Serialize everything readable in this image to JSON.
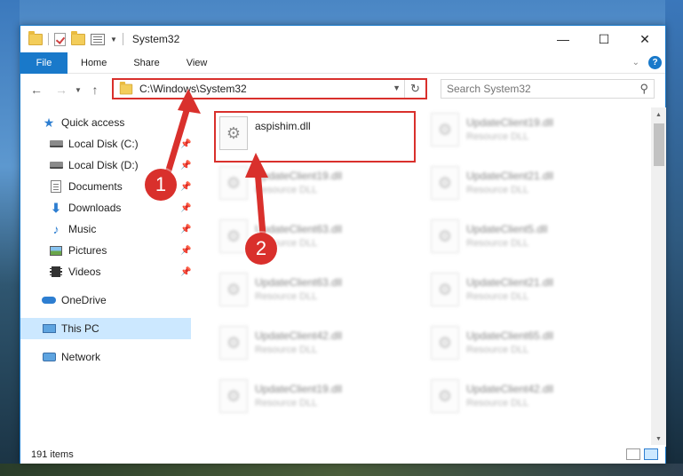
{
  "window": {
    "title": "System32",
    "controls": {
      "minimize": "—",
      "maximize": "☐",
      "close": "✕"
    }
  },
  "ribbon": {
    "tabs": [
      "File",
      "Home",
      "Share",
      "View"
    ],
    "help": "?"
  },
  "address_bar": {
    "path": "C:\\Windows\\System32",
    "refresh": "↻"
  },
  "search": {
    "placeholder": "Search System32"
  },
  "nav_pane": {
    "items": [
      {
        "label": "Quick access",
        "icon": "star-icon",
        "pinned": false
      },
      {
        "label": "Local Disk (C:)",
        "icon": "disk-icon",
        "pinned": true
      },
      {
        "label": "Local Disk (D:)",
        "icon": "disk-icon",
        "pinned": true
      },
      {
        "label": "Documents",
        "icon": "documents-icon",
        "pinned": true
      },
      {
        "label": "Downloads",
        "icon": "downloads-icon",
        "pinned": true
      },
      {
        "label": "Music",
        "icon": "music-icon",
        "pinned": true
      },
      {
        "label": "Pictures",
        "icon": "pictures-icon",
        "pinned": true
      },
      {
        "label": "Videos",
        "icon": "videos-icon",
        "pinned": true
      },
      {
        "label": "OneDrive",
        "icon": "onedrive-icon",
        "pinned": false
      },
      {
        "label": "This PC",
        "icon": "this-pc-icon",
        "pinned": false,
        "selected": true
      },
      {
        "label": "Network",
        "icon": "network-icon",
        "pinned": false
      }
    ]
  },
  "files": {
    "highlighted": {
      "name": "aspishim.dll"
    },
    "left_column": [
      {
        "name": "UpdateClient19.dll",
        "type": "Resource DLL"
      },
      {
        "name": "UpdateClient63.dll",
        "type": "Resource DLL"
      },
      {
        "name": "UpdateClient63.dll",
        "type": "Resource DLL"
      },
      {
        "name": "UpdateClient42.dll",
        "type": "Resource DLL"
      },
      {
        "name": "UpdateClient19.dll",
        "type": "Resource DLL"
      }
    ],
    "right_column": [
      {
        "name": "UpdateClient19.dll",
        "type": "Resource DLL"
      },
      {
        "name": "UpdateClient21.dll",
        "type": "Resource DLL"
      },
      {
        "name": "UpdateClient5.dll",
        "type": "Resource DLL"
      },
      {
        "name": "UpdateClient21.dll",
        "type": "Resource DLL"
      },
      {
        "name": "UpdateClient65.dll",
        "type": "Resource DLL"
      },
      {
        "name": "UpdateClient42.dll",
        "type": "Resource DLL"
      }
    ]
  },
  "status": {
    "items": "191 items"
  },
  "annotations": {
    "step1": "1",
    "step2": "2"
  },
  "colors": {
    "accent": "#1979ca",
    "annotation_red": "#d9302c",
    "selected_bg": "#cce8ff"
  }
}
